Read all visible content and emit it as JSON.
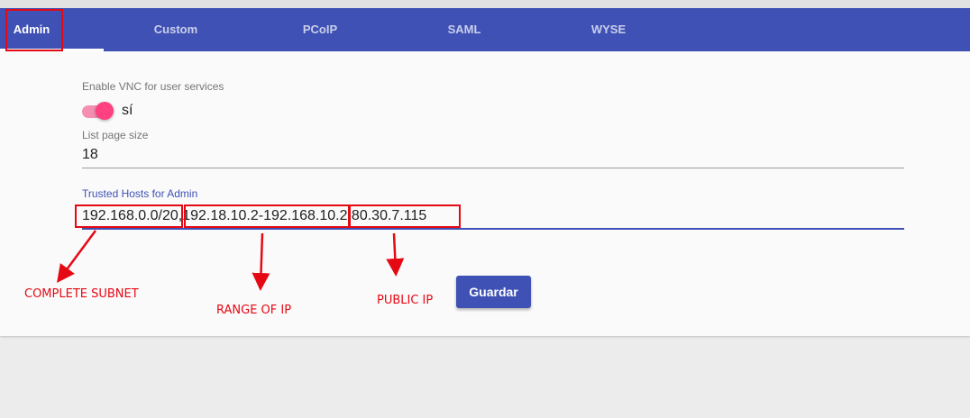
{
  "tabs": [
    {
      "label": "Admin",
      "active": true
    },
    {
      "label": "Custom",
      "active": false
    },
    {
      "label": "PCoIP",
      "active": false
    },
    {
      "label": "SAML",
      "active": false
    },
    {
      "label": "WYSE",
      "active": false
    }
  ],
  "vnc": {
    "label": "Enable VNC for user services",
    "toggle_text": "sí",
    "enabled": true
  },
  "list_page_size": {
    "label": "List page size",
    "value": "18"
  },
  "trusted_hosts": {
    "label": "Trusted Hosts for Admin",
    "value": "192.168.0.0/20,192.18.10.2-192.168.10.2,80.30.7.115"
  },
  "save_button": "Guardar",
  "annotations": {
    "subnet": "COMPLETE SUBNET",
    "range": "RANGE OF IP",
    "public": "PUBLIC IP"
  },
  "colors": {
    "primary": "#3f51b5",
    "accent": "#ff4081",
    "annotation": "#e50914"
  }
}
